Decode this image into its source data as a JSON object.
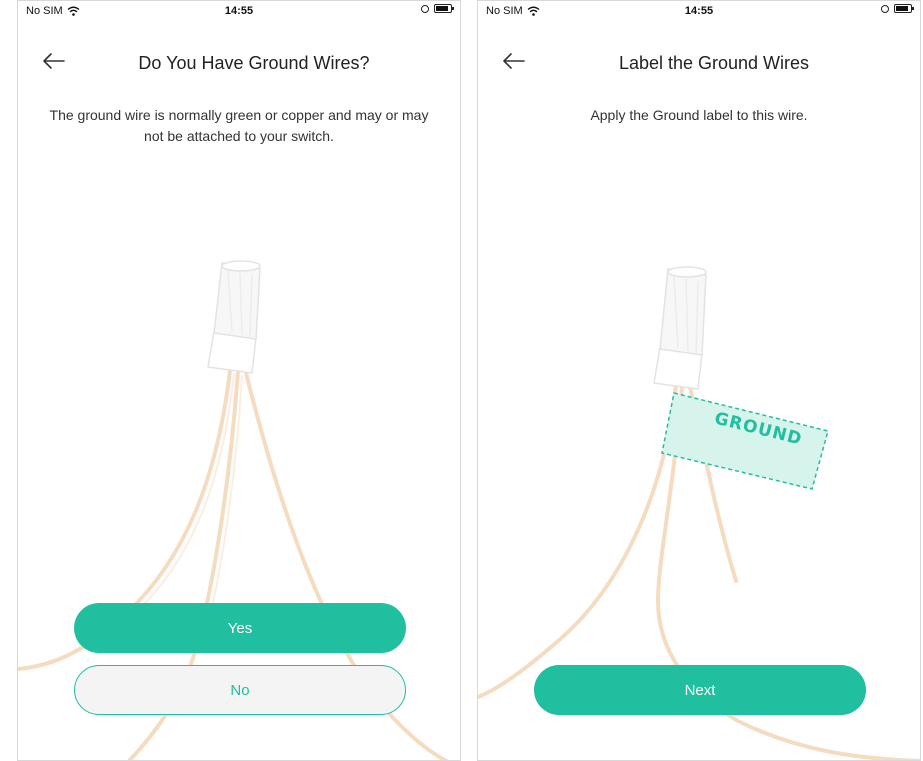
{
  "screens": [
    {
      "status": {
        "carrier": "No SIM",
        "time": "14:55"
      },
      "title": "Do You Have Ground Wires?",
      "description": "The ground wire is normally green or copper and may or may not be attached to your switch.",
      "buttons": {
        "yes": "Yes",
        "no": "No"
      }
    },
    {
      "status": {
        "carrier": "No SIM",
        "time": "14:55"
      },
      "title": "Label the Ground Wires",
      "description": "Apply the Ground label to this wire.",
      "label_text": "GROUND",
      "buttons": {
        "next": "Next"
      }
    }
  ],
  "colors": {
    "accent": "#20bfa0",
    "wire": "#f5dcc0"
  },
  "icons": [
    "back-arrow-icon",
    "wifi-icon",
    "battery-icon",
    "orientation-lock-icon"
  ]
}
